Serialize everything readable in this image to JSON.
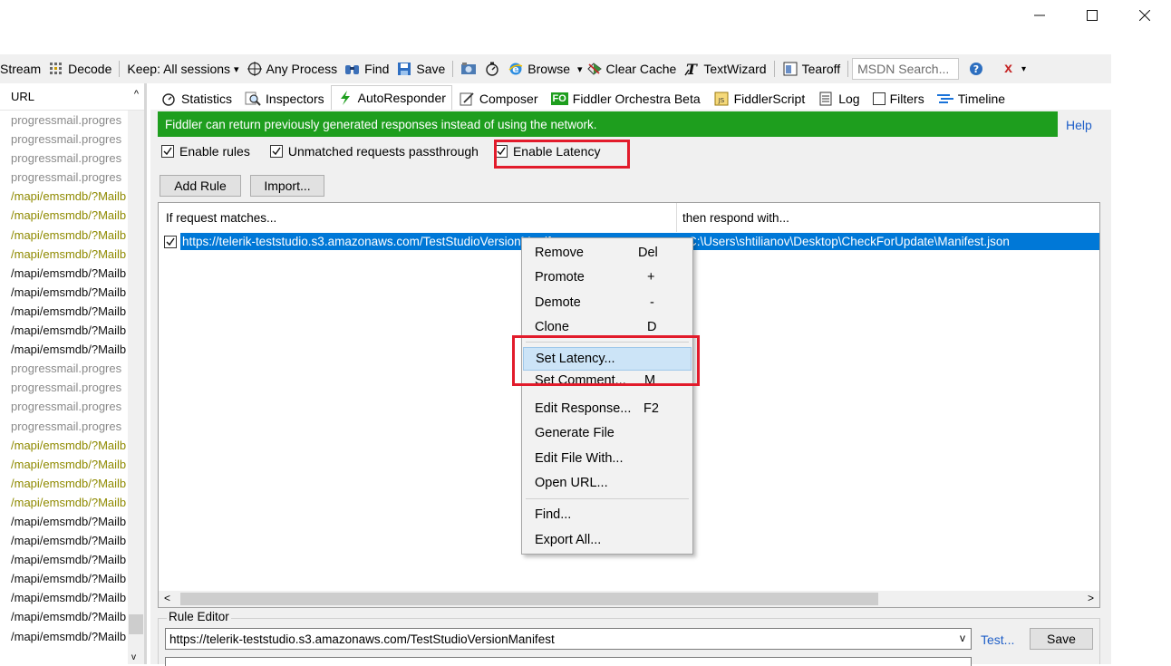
{
  "window": {
    "minimize_glyph": "—",
    "maximize_glyph": "☐",
    "close_glyph": "✕"
  },
  "toolbar": {
    "stream": "Stream",
    "decode": "Decode",
    "keep": "Keep: All sessions",
    "keep_caret": "▾",
    "any_process": "Any Process",
    "find": "Find",
    "save": "Save",
    "browse": "Browse",
    "browse_caret": "▾",
    "clear_cache": "Clear Cache",
    "textwizard": "TextWizard",
    "tearoff": "Tearoff",
    "msdn_placeholder": "MSDN Search...",
    "close_x": "x",
    "overflow": "▾"
  },
  "left_pane": {
    "header": "URL",
    "caret_up": "^",
    "caret_down": "v",
    "rows": [
      {
        "text": "progressmail.progres",
        "tone": "gray"
      },
      {
        "text": "progressmail.progres",
        "tone": "gray"
      },
      {
        "text": "progressmail.progres",
        "tone": "gray"
      },
      {
        "text": "progressmail.progres",
        "tone": "gray"
      },
      {
        "text": "/mapi/emsmdb/?Mailb",
        "tone": "olive"
      },
      {
        "text": "/mapi/emsmdb/?Mailb",
        "tone": "olive"
      },
      {
        "text": "/mapi/emsmdb/?Mailb",
        "tone": "olive"
      },
      {
        "text": "/mapi/emsmdb/?Mailb",
        "tone": "olive"
      },
      {
        "text": "/mapi/emsmdb/?Mailb",
        "tone": "black"
      },
      {
        "text": "/mapi/emsmdb/?Mailb",
        "tone": "black"
      },
      {
        "text": "/mapi/emsmdb/?Mailb",
        "tone": "black"
      },
      {
        "text": "/mapi/emsmdb/?Mailb",
        "tone": "black"
      },
      {
        "text": "/mapi/emsmdb/?Mailb",
        "tone": "black"
      },
      {
        "text": "progressmail.progres",
        "tone": "gray"
      },
      {
        "text": "progressmail.progres",
        "tone": "gray"
      },
      {
        "text": "progressmail.progres",
        "tone": "gray"
      },
      {
        "text": "progressmail.progres",
        "tone": "gray"
      },
      {
        "text": "/mapi/emsmdb/?Mailb",
        "tone": "olive"
      },
      {
        "text": "/mapi/emsmdb/?Mailb",
        "tone": "olive"
      },
      {
        "text": "/mapi/emsmdb/?Mailb",
        "tone": "olive"
      },
      {
        "text": "/mapi/emsmdb/?Mailb",
        "tone": "olive"
      },
      {
        "text": "/mapi/emsmdb/?Mailb",
        "tone": "black"
      },
      {
        "text": "/mapi/emsmdb/?Mailb",
        "tone": "black"
      },
      {
        "text": "/mapi/emsmdb/?Mailb",
        "tone": "black"
      },
      {
        "text": "/mapi/emsmdb/?Mailb",
        "tone": "black"
      },
      {
        "text": "/mapi/emsmdb/?Mailb",
        "tone": "black"
      },
      {
        "text": "/mapi/emsmdb/?Mailb",
        "tone": "black"
      },
      {
        "text": "/mapi/emsmdb/?Mailb",
        "tone": "black"
      }
    ]
  },
  "tabs": {
    "statistics": "Statistics",
    "inspectors": "Inspectors",
    "autoresponder": "AutoResponder",
    "composer": "Composer",
    "fo_badge": "FO",
    "orchestra": "Fiddler Orchestra Beta",
    "fiddlerscript": "FiddlerScript",
    "log": "Log",
    "filters": "Filters",
    "timeline": "Timeline"
  },
  "autoresponder": {
    "banner": "Fiddler can return previously generated responses instead of using the network.",
    "help": "Help",
    "enable_rules": "Enable rules",
    "unmatched": "Unmatched requests passthrough",
    "enable_latency": "Enable Latency",
    "add_rule": "Add Rule",
    "import": "Import...",
    "col_match": "If request matches...",
    "col_respond": "then respond with...",
    "rule_match": "https://telerik-teststudio.s3.amazonaws.com/TestStudioVersionManifest",
    "rule_respond": "C:\\Users\\shtilianov\\Desktop\\CheckForUpdate\\Manifest.json",
    "scroll_left": "<",
    "scroll_right": ">",
    "rule_editor": "Rule Editor",
    "editor_value": "https://telerik-teststudio.s3.amazonaws.com/TestStudioVersionManifest",
    "editor_caret": "v",
    "test": "Test...",
    "save": "Save"
  },
  "context_menu": {
    "remove": "Remove",
    "remove_sc": "Del",
    "promote": "Promote",
    "promote_sc": "+",
    "demote": "Demote",
    "demote_sc": "-",
    "clone": "Clone",
    "clone_sc": "D",
    "set_latency": "Set Latency...",
    "set_comment": "Set Comment...",
    "set_comment_sc": "M",
    "edit_response": "Edit Response...",
    "edit_response_sc": "F2",
    "generate_file": "Generate File",
    "edit_file_with": "Edit File With...",
    "open_url": "Open URL...",
    "find": "Find...",
    "export_all": "Export All..."
  },
  "colors": {
    "banner": "#1e9e1e",
    "selection": "#0078d7",
    "highlight_box": "#e21b2b",
    "link": "#1f5fc8"
  }
}
